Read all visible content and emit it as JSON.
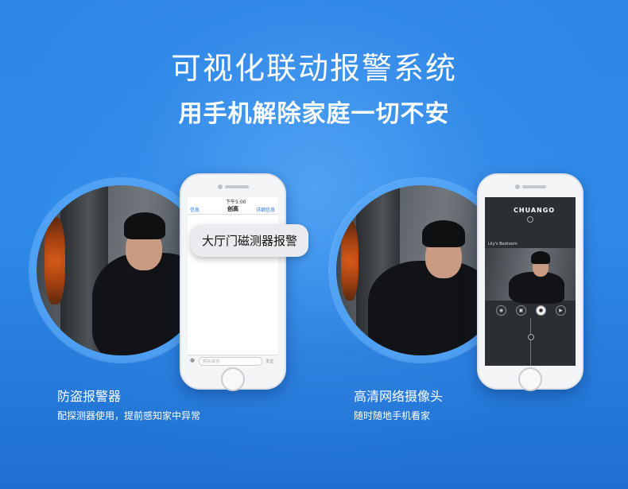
{
  "header": {
    "title": "可视化联动报警系统",
    "subtitle": "用手机解除家庭一切不安"
  },
  "left_panel": {
    "feature_title": "防盗报警器",
    "feature_desc": "配探测器使用，提前感知家中异常",
    "phone": {
      "status_time": "下午5:00",
      "nav_back": "信息",
      "nav_title": "创高",
      "nav_detail": "详细信息",
      "message": "大厅门磁测器报警",
      "input_placeholder": "短信/彩信",
      "send_label": "发送"
    }
  },
  "right_panel": {
    "feature_title": "高清网络摄像头",
    "feature_desc": "随时随地手机看家",
    "phone": {
      "brand": "CHUANGO",
      "camera_label": "Lily's Bedroom",
      "controls": [
        "camera-icon",
        "record-icon",
        "mic-icon",
        "speaker-icon"
      ]
    }
  },
  "colors": {
    "background": "#2e86e6",
    "circle_border": "#5aaafa",
    "text": "#ffffff"
  }
}
